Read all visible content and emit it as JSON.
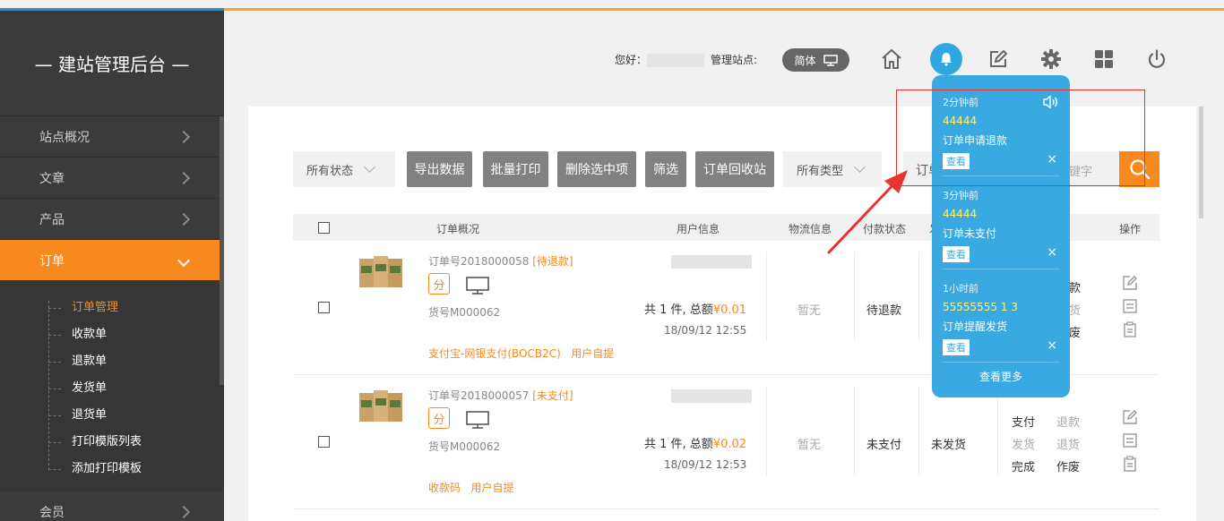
{
  "sidebar": {
    "brand": "— 建站管理后台 —",
    "items": [
      {
        "label": "站点概况"
      },
      {
        "label": "文章"
      },
      {
        "label": "产品"
      },
      {
        "label": "订单"
      },
      {
        "label": "会员"
      }
    ],
    "sub_items": [
      {
        "label": "订单管理"
      },
      {
        "label": "收款单"
      },
      {
        "label": "退款单"
      },
      {
        "label": "发货单"
      },
      {
        "label": "退货单"
      },
      {
        "label": "打印模版列表"
      },
      {
        "label": "添加打印模板"
      }
    ]
  },
  "header": {
    "greeting": "您好：",
    "site_label": "管理站点:",
    "lang_button": "简体",
    "icons": [
      "home-icon",
      "bell-icon",
      "edit-icon",
      "gear-icon",
      "grid-icon",
      "power-icon"
    ],
    "accent_color": "#f7891f",
    "popup_color": "#3aa9e2"
  },
  "toolbar": {
    "status_filter": "所有状态",
    "buttons": [
      "导出数据",
      "批量打印",
      "删除选中项",
      "筛选",
      "订单回收站"
    ],
    "type_filter": "所有类型",
    "search_label": "订单",
    "search_placeholder": "键字"
  },
  "table": {
    "headers": [
      "订单概况",
      "用户信息",
      "物流信息",
      "付款状态",
      "发",
      "操作"
    ]
  },
  "orders": [
    {
      "order_no": "订单号2018000058",
      "status_tag": "[待退款]",
      "fen": "分",
      "sku": "货号M000062",
      "total_prefix": "共 1 件, 总额",
      "amount": "¥0.01",
      "time": "18/09/12 12:55",
      "payment": "支付宝-网银支付(BOCB2C)",
      "source": "用户自提",
      "logistics": "暂无",
      "pay_status": "待退款",
      "actions": [
        "款",
        "货",
        "废"
      ]
    },
    {
      "order_no": "订单号2018000057",
      "status_tag": "[未支付]",
      "fen": "分",
      "sku": "货号M000062",
      "total_prefix": "共 1 件, 总额",
      "amount": "¥0.02",
      "time": "18/09/12 12:53",
      "payment": "收款码",
      "source": "用户自提",
      "logistics": "暂无",
      "pay_status": "未支付",
      "ship_status": "未发货",
      "actions": [
        "支付",
        "退款",
        "发货",
        "退货",
        "完成",
        "作废"
      ]
    }
  ],
  "notifications": {
    "items": [
      {
        "time": "2分钟前",
        "id": "44444",
        "message": "订单申请退款",
        "view": "查看",
        "close": "×"
      },
      {
        "time": "3分钟前",
        "id": "44444",
        "message": "订单未支付",
        "view": "查看",
        "close": "×"
      },
      {
        "time": "1小时前",
        "id": "55555555 1 3",
        "message": "订单提醒发货",
        "view": "查看",
        "close": "×"
      }
    ],
    "more": "查看更多"
  }
}
